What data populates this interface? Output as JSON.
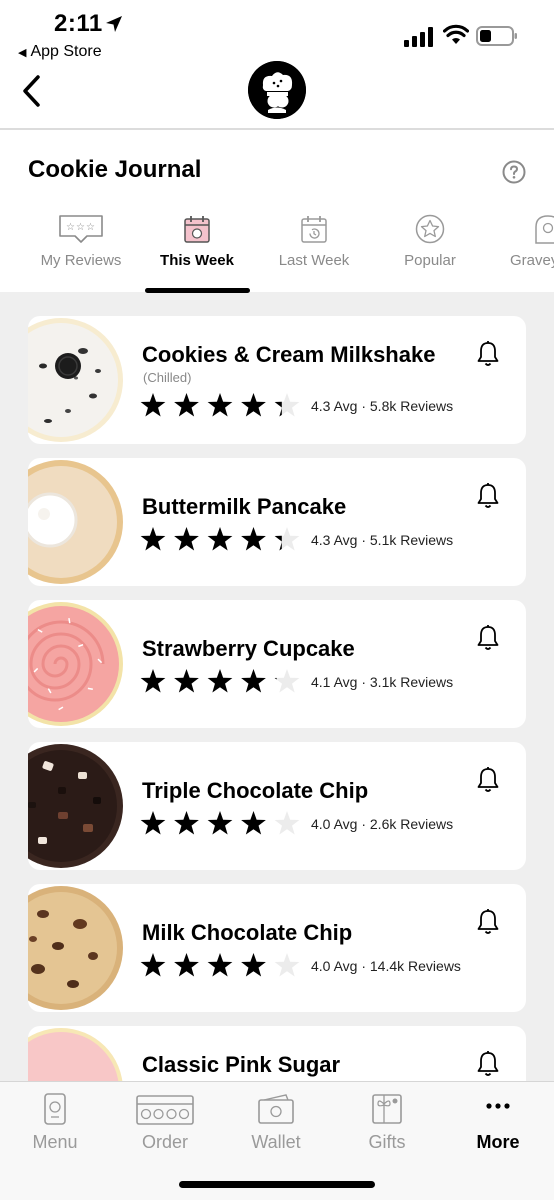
{
  "status_bar": {
    "time": "2:11",
    "back_app": "App Store"
  },
  "page": {
    "title": "Cookie Journal"
  },
  "tabs": [
    {
      "label": "My Reviews",
      "icon": "review-stars-icon",
      "active": false
    },
    {
      "label": "This Week",
      "icon": "calendar-cookie-icon",
      "active": true
    },
    {
      "label": "Last Week",
      "icon": "calendar-history-icon",
      "active": false
    },
    {
      "label": "Popular",
      "icon": "star-circle-icon",
      "active": false
    },
    {
      "label": "Gravey",
      "icon": "tombstone-icon",
      "active": false
    }
  ],
  "cookies": [
    {
      "name": "Cookies & Cream Milkshake",
      "subtitle": "(Chilled)",
      "rating": 4.3,
      "rating_text": "4.3 Avg · 5.8k Reviews",
      "cookie_icon": "cookies-and-cream-cookie"
    },
    {
      "name": "Buttermilk Pancake",
      "subtitle": "",
      "rating": 4.3,
      "rating_text": "4.3 Avg · 5.1k Reviews",
      "cookie_icon": "buttermilk-pancake-cookie"
    },
    {
      "name": "Strawberry Cupcake",
      "subtitle": "",
      "rating": 4.1,
      "rating_text": "4.1 Avg · 3.1k Reviews",
      "cookie_icon": "strawberry-cupcake-cookie"
    },
    {
      "name": "Triple Chocolate Chip",
      "subtitle": "",
      "rating": 4.0,
      "rating_text": "4.0 Avg · 2.6k Reviews",
      "cookie_icon": "triple-chocolate-chip-cookie"
    },
    {
      "name": "Milk Chocolate Chip",
      "subtitle": "",
      "rating": 4.0,
      "rating_text": "4.0 Avg · 14.4k Reviews",
      "cookie_icon": "milk-chocolate-chip-cookie"
    },
    {
      "name": "Classic Pink Sugar",
      "subtitle": "",
      "rating": null,
      "rating_text": "",
      "cookie_icon": "classic-pink-sugar-cookie"
    }
  ],
  "bottom_nav": [
    {
      "label": "Menu",
      "icon": "menu-phone-icon",
      "active": false
    },
    {
      "label": "Order",
      "icon": "cookie-box-icon",
      "active": false
    },
    {
      "label": "Wallet",
      "icon": "wallet-icon",
      "active": false
    },
    {
      "label": "Gifts",
      "icon": "gift-icon",
      "active": false
    },
    {
      "label": "More",
      "icon": "more-dots-icon",
      "active": true
    }
  ],
  "colors": {
    "background": "#efefef",
    "card": "#ffffff",
    "active_tab_icon": "#f4c2cc",
    "inactive_text": "#8a8a8a"
  }
}
